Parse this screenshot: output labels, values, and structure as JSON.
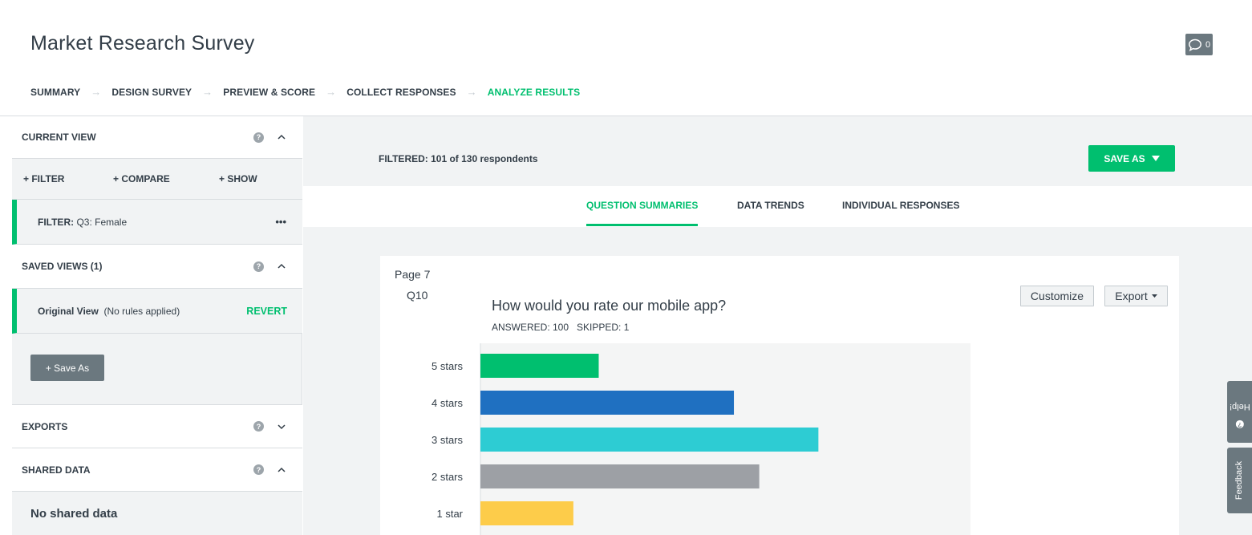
{
  "header": {
    "title": "Market Research Survey",
    "comment_count": "0"
  },
  "steps": [
    {
      "label": "SUMMARY"
    },
    {
      "label": "DESIGN SURVEY"
    },
    {
      "label": "PREVIEW & SCORE"
    },
    {
      "label": "COLLECT RESPONSES"
    },
    {
      "label": "ANALYZE RESULTS",
      "active": true
    }
  ],
  "sidebar": {
    "current_view": "CURRENT VIEW",
    "filter_action": "+ FILTER",
    "compare_action": "+ COMPARE",
    "show_action": "+ SHOW",
    "filter_prefix": "FILTER:",
    "filter_value": "Q3: Female",
    "more": "•••",
    "saved_views": "SAVED VIEWS (1)",
    "original_view": "Original View",
    "original_view_note": "(No rules applied)",
    "revert": "REVERT",
    "save_as": "+ Save As",
    "exports": "EXPORTS",
    "shared_data": "SHARED DATA",
    "no_shared": "No shared data"
  },
  "main": {
    "filtered": "FILTERED: 101 of 130 respondents",
    "save_as": "SAVE AS",
    "tabs": [
      "QUESTION SUMMARIES",
      "DATA TRENDS",
      "INDIVIDUAL RESPONSES"
    ],
    "active_tab": "QUESTION SUMMARIES"
  },
  "question": {
    "page": "Page 7",
    "number": "Q10",
    "text": "How would you rate our mobile app?",
    "meta": "ANSWERED: 100   SKIPPED: 1",
    "customize": "Customize",
    "export": "Export"
  },
  "side_tabs": {
    "help": "Help!",
    "feedback": "Feedback"
  },
  "colors": {
    "accent": "#00bf6f",
    "sidebar_bg": "#f1f3f4",
    "button_gray": "#6b787f"
  },
  "chart_data": {
    "type": "bar",
    "orientation": "horizontal",
    "categories": [
      "5 stars",
      "4 stars",
      "3 stars",
      "2 stars",
      "1 star"
    ],
    "values": [
      14,
      30,
      40,
      33,
      11
    ],
    "unit": "%",
    "xlim": [
      0,
      58
    ],
    "colors": [
      "#00bf6f",
      "#1f70c1",
      "#2dccd3",
      "#9da0a5",
      "#fdcc4a"
    ],
    "grid": false,
    "legend": "none"
  }
}
